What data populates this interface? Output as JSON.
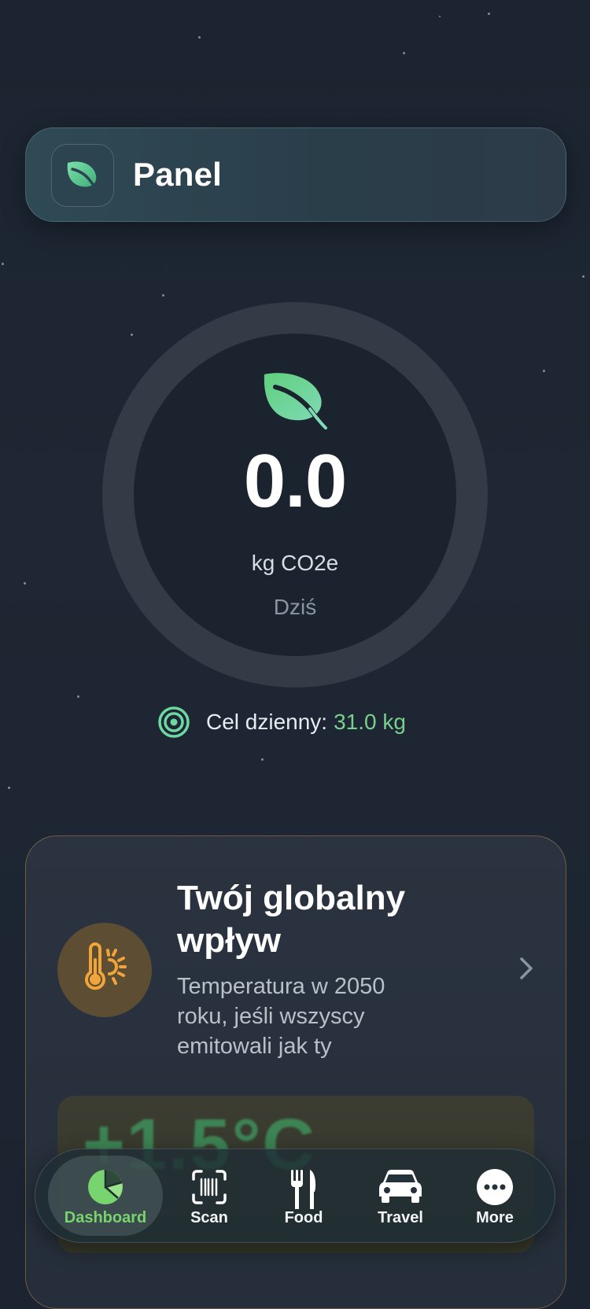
{
  "header": {
    "title": "Panel",
    "icon": "leaf-icon"
  },
  "today": {
    "value": "0.0",
    "unit": "kg CO2e",
    "period": "Dziś"
  },
  "goal": {
    "label": "Cel dzienny:",
    "value": "31.0 kg"
  },
  "impact_card": {
    "title": "Twój globalny wpływ",
    "description": "Temperatura w 2050 roku, jeśli wszyscy emitowali jak ty",
    "temperature": "+1.5°C"
  },
  "tabs": [
    {
      "label": "Dashboard",
      "icon": "pie-chart-icon",
      "active": true
    },
    {
      "label": "Scan",
      "icon": "barcode-scan-icon",
      "active": false
    },
    {
      "label": "Food",
      "icon": "fork-knife-icon",
      "active": false
    },
    {
      "label": "Travel",
      "icon": "car-icon",
      "active": false
    },
    {
      "label": "More",
      "icon": "more-icon",
      "active": false
    }
  ],
  "colors": {
    "accent": "#78d08c",
    "warm": "#f0a43a",
    "background": "#1b2430"
  }
}
